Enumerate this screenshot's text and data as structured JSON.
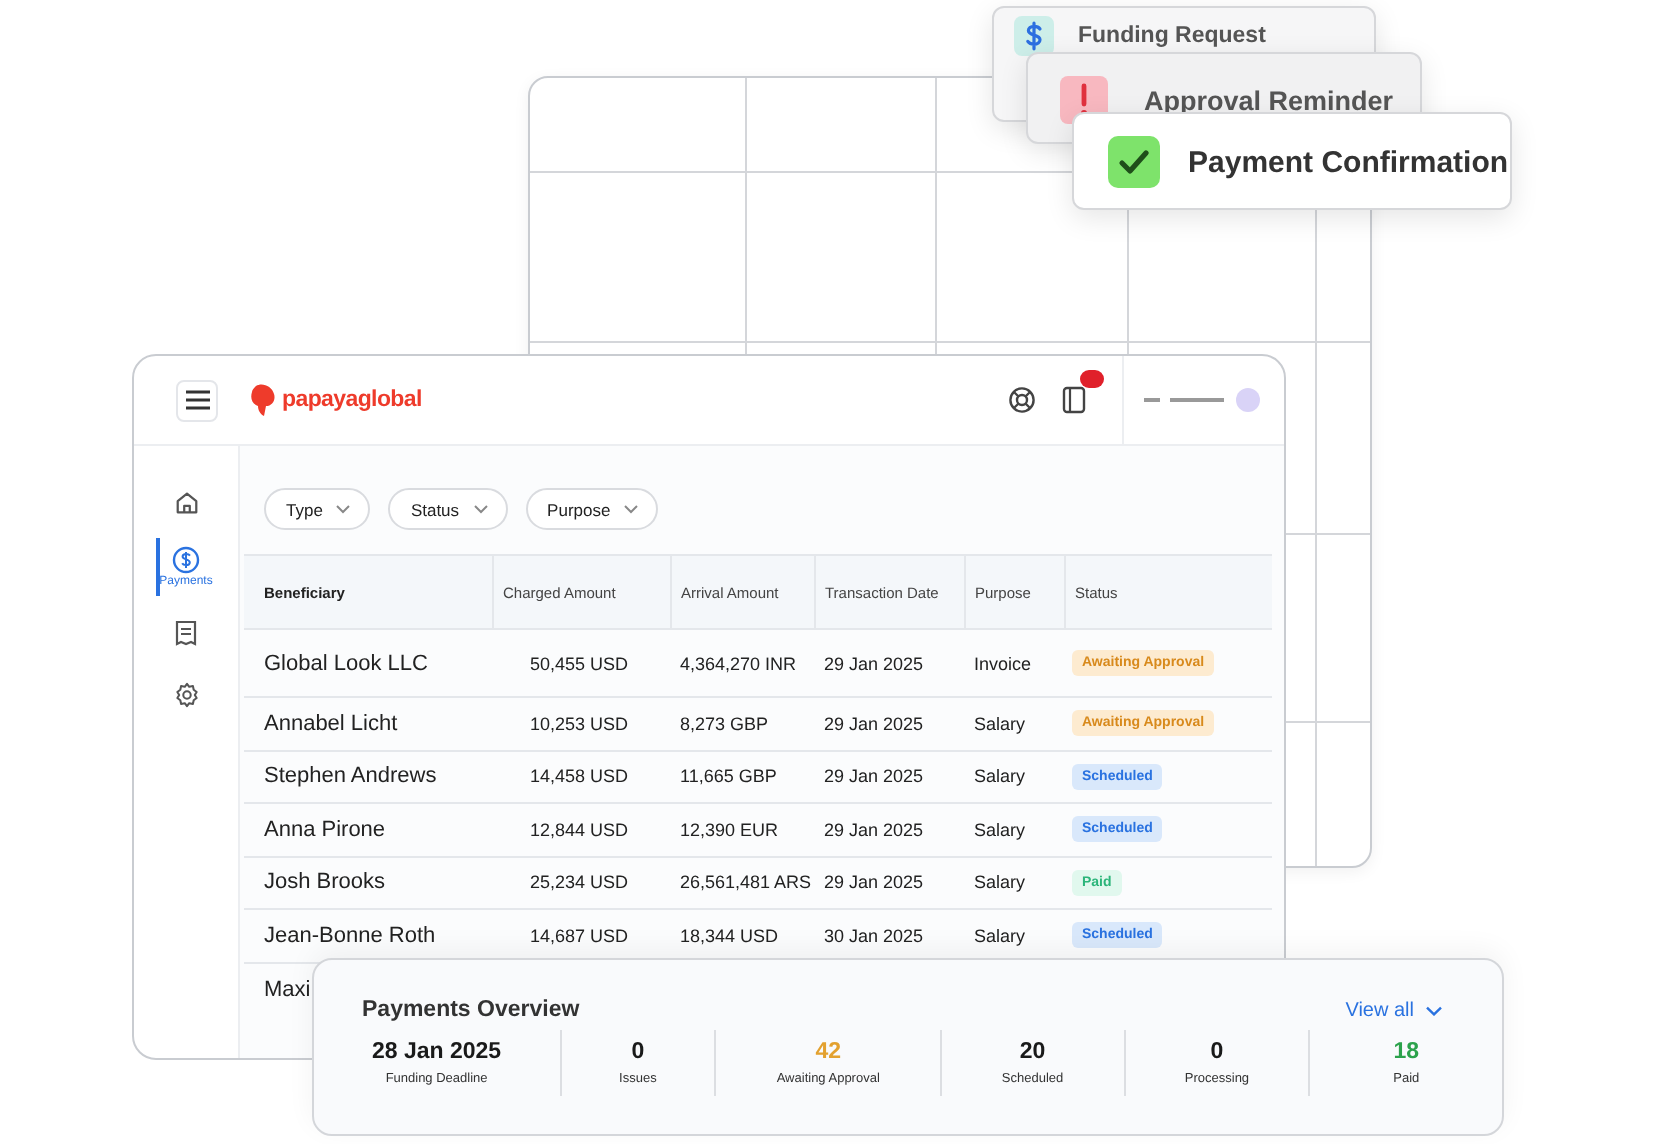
{
  "notifications": [
    {
      "kind": "dollar",
      "title": "Funding Request"
    },
    {
      "kind": "alert",
      "title": "Approval Reminder"
    },
    {
      "kind": "check",
      "title": "Payment Confirmation"
    }
  ],
  "header": {
    "logo": "papayaglobal",
    "notification_badge": true
  },
  "sidebar": {
    "items": [
      {
        "kind": "home",
        "selected": false
      },
      {
        "kind": "payments",
        "label": "Payments",
        "selected": true
      },
      {
        "kind": "receipt",
        "selected": false
      },
      {
        "kind": "settings",
        "selected": false
      }
    ]
  },
  "filters": [
    "Type",
    "Status",
    "Purpose"
  ],
  "table": {
    "columns": [
      "Beneficiary",
      "Charged Amount",
      "Arrival Amount",
      "Transaction Date",
      "Purpose",
      "Status"
    ],
    "rows": [
      {
        "beneficiary": "Global Look LLC",
        "charged": "50,455 USD",
        "arrival": "4,364,270 INR",
        "date": "29 Jan 2025",
        "purpose": "Invoice",
        "status": {
          "label": "Awaiting Approval",
          "kind": "awaiting"
        }
      },
      {
        "beneficiary": "Annabel Licht",
        "charged": "10,253 USD",
        "arrival": "8,273 GBP",
        "date": "29 Jan 2025",
        "purpose": "Salary",
        "status": {
          "label": "Awaiting Approval",
          "kind": "awaiting"
        }
      },
      {
        "beneficiary": "Stephen Andrews",
        "charged": "14,458 USD",
        "arrival": "11,665 GBP",
        "date": "29 Jan 2025",
        "purpose": "Salary",
        "status": {
          "label": "Scheduled",
          "kind": "scheduled"
        }
      },
      {
        "beneficiary": "Anna Pirone",
        "charged": "12,844 USD",
        "arrival": "12,390 EUR",
        "date": "29 Jan 2025",
        "purpose": "Salary",
        "status": {
          "label": "Scheduled",
          "kind": "scheduled"
        }
      },
      {
        "beneficiary": "Josh Brooks",
        "charged": "25,234 USD",
        "arrival": "26,561,481 ARS",
        "date": "29 Jan 2025",
        "purpose": "Salary",
        "status": {
          "label": "Paid",
          "kind": "paid"
        }
      },
      {
        "beneficiary": "Jean-Bonne Roth",
        "charged": "14,687 USD",
        "arrival": "18,344 USD",
        "date": "30 Jan 2025",
        "purpose": "Salary",
        "status": {
          "label": "Scheduled",
          "kind": "scheduled"
        }
      },
      {
        "beneficiary": "Maxi"
      }
    ]
  },
  "overview": {
    "title": "Payments Overview",
    "link": "View all",
    "stats": [
      {
        "value": "28 Jan 2025",
        "label": "Funding Deadline",
        "color": "#1a1a1a"
      },
      {
        "value": "0",
        "label": "Issues",
        "color": "#1a1a1a"
      },
      {
        "value": "42",
        "label": "Awaiting Approval",
        "color": "#e3a12f"
      },
      {
        "value": "20",
        "label": "Scheduled",
        "color": "#1a1a1a"
      },
      {
        "value": "0",
        "label": "Processing",
        "color": "#1a1a1a"
      },
      {
        "value": "18",
        "label": "Paid",
        "color": "#2ca24c"
      }
    ]
  }
}
